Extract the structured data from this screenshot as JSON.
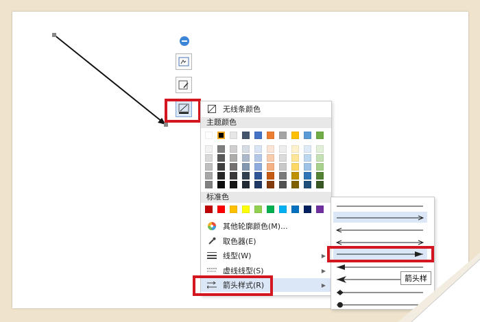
{
  "menu": {
    "no_line_color": "无线条颜色",
    "theme_colors": "主题颜色",
    "standard_colors": "标准色",
    "more_outline_colors": "其他轮廓颜色(M)...",
    "eyedropper": "取色器(E)",
    "line_type": "线型(W)",
    "dash_type": "虚线线型(S)",
    "arrow_style": "箭头样式(R)"
  },
  "tooltip": {
    "text": "箭头样"
  },
  "icons": {
    "collapse": "minus-circle-icon",
    "style": "shape-style-icon",
    "fill": "fill-edit-icon",
    "outline": "line-color-icon"
  },
  "colors": {
    "accent_red": "#d3161f",
    "theme_top": [
      "#ffffff",
      "#000000",
      "#e7e6e6",
      "#44546a",
      "#4472c4",
      "#ed7d31",
      "#a5a5a5",
      "#ffc000",
      "#5b9bd5",
      "#70ad47"
    ],
    "theme_shades": [
      [
        "#f2f2f2",
        "#7f7f7f",
        "#d0cece",
        "#d6dce4",
        "#dae3f3",
        "#fbe5d6",
        "#ededed",
        "#fff2cc",
        "#deebf7",
        "#e2f0d9"
      ],
      [
        "#d9d9d9",
        "#595959",
        "#aeabab",
        "#adb9ca",
        "#b4c7e7",
        "#f8cbad",
        "#dbdbdb",
        "#ffe699",
        "#bdd7ee",
        "#c5e0b4"
      ],
      [
        "#bfbfbf",
        "#404040",
        "#757171",
        "#8497b0",
        "#8faadc",
        "#f4b183",
        "#c9c9c9",
        "#ffd966",
        "#9dc3e6",
        "#a9d18e"
      ],
      [
        "#a6a6a6",
        "#262626",
        "#3a3838",
        "#323f4f",
        "#2f5597",
        "#c55a11",
        "#7b7b7b",
        "#bf9000",
        "#2e75b6",
        "#548235"
      ],
      [
        "#808080",
        "#0d0d0d",
        "#171616",
        "#222a35",
        "#203864",
        "#843c0c",
        "#525252",
        "#7f6000",
        "#1f4e79",
        "#385723"
      ]
    ],
    "standard": [
      "#c00000",
      "#ff0000",
      "#ffc000",
      "#ffff00",
      "#92d050",
      "#00b050",
      "#00b0f0",
      "#0070c0",
      "#002060",
      "#7030a0"
    ]
  }
}
